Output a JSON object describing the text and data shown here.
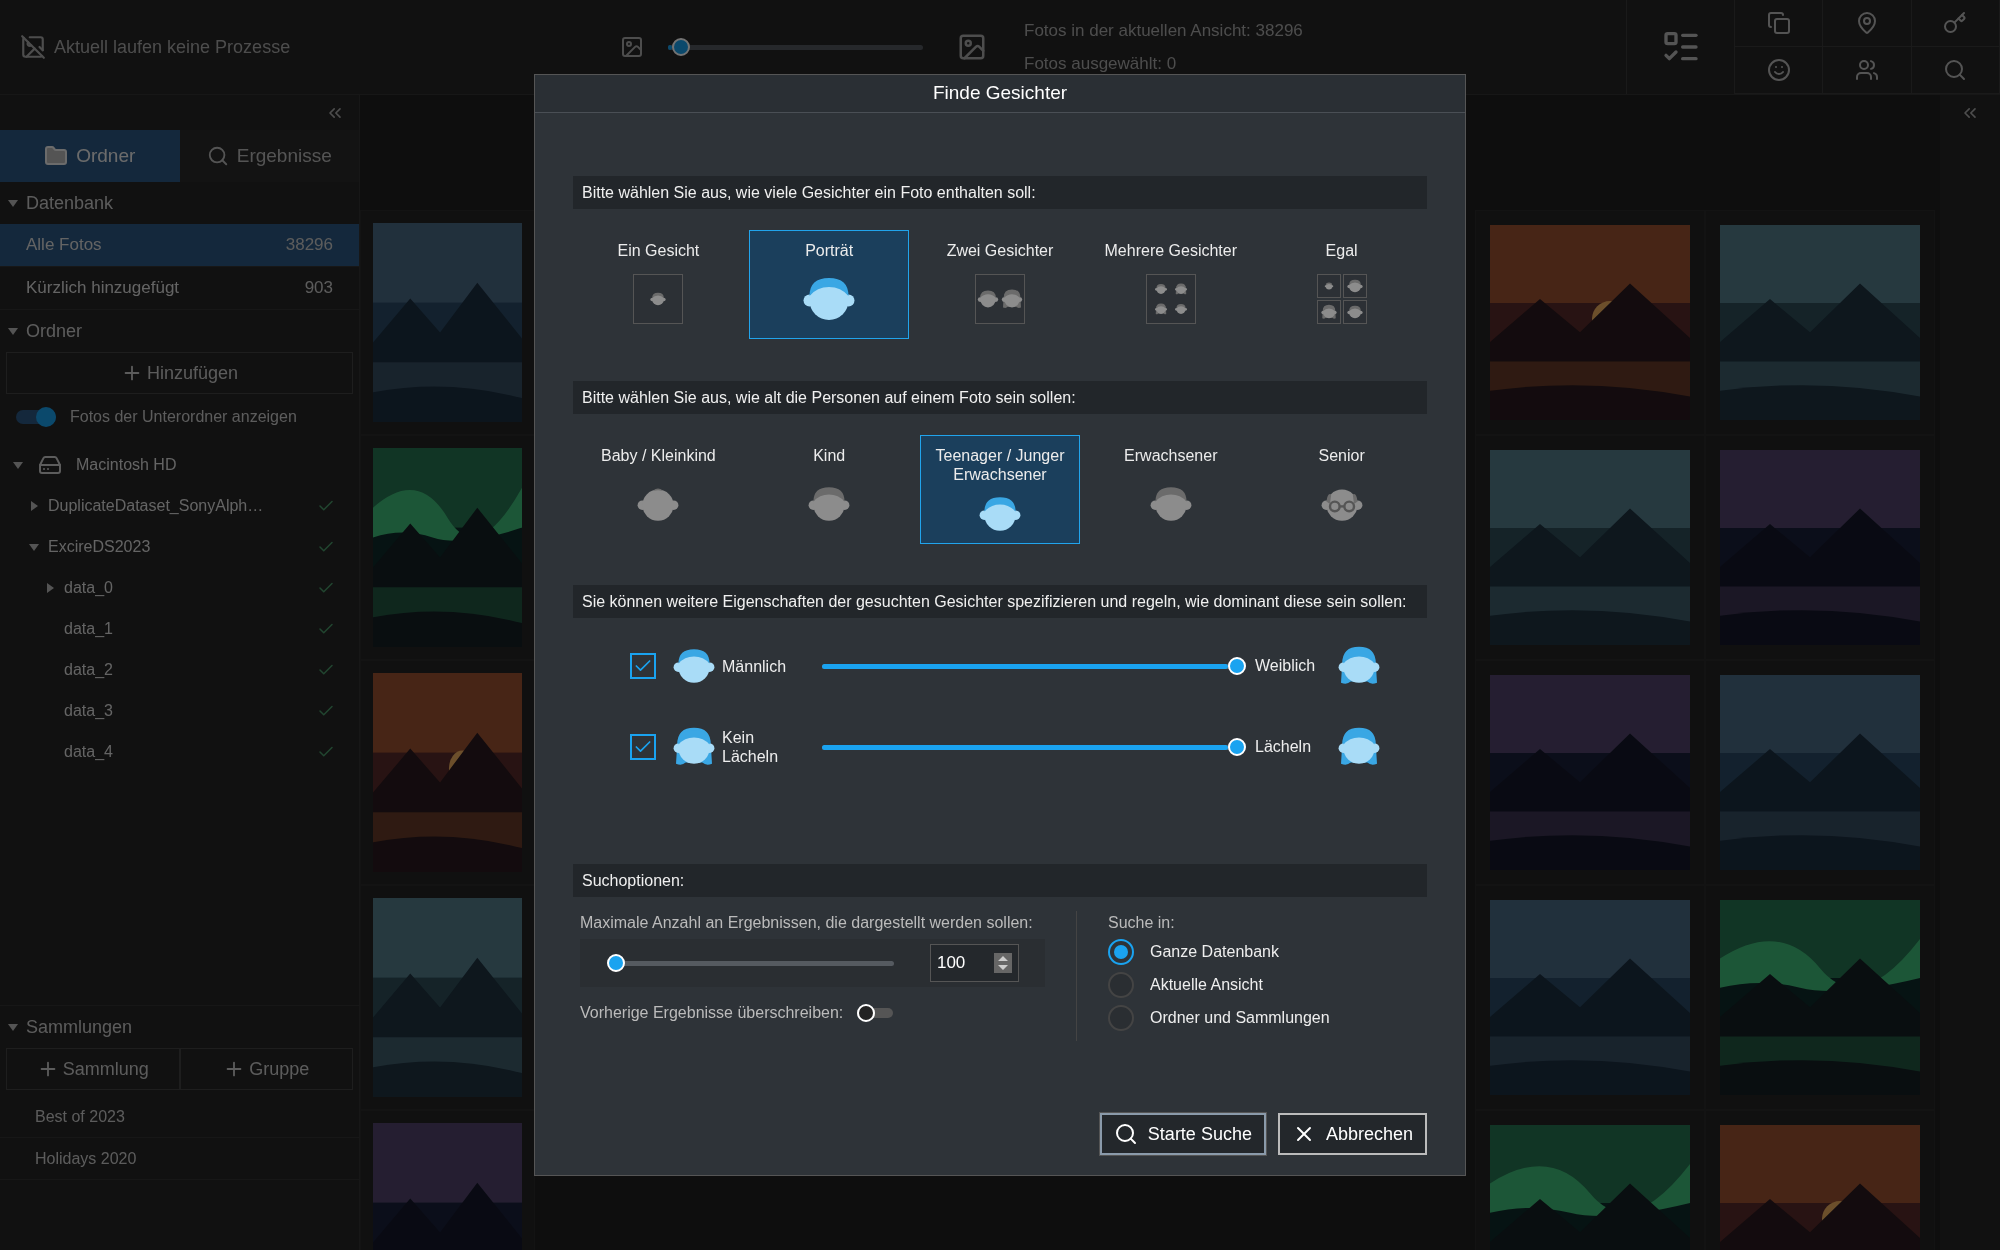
{
  "status": {
    "text": "Aktuell laufen keine Prozesse"
  },
  "thumbnail_size": {
    "level": 0.05
  },
  "stats": [
    "Fotos in der aktuellen Ansicht: 38296",
    "Fotos ausgewählt: 0"
  ],
  "sidebar": {
    "tabs": [
      {
        "label": "Ordner",
        "selected": true
      },
      {
        "label": "Ergebnisse",
        "selected": false
      }
    ],
    "database": {
      "title": "Datenbank",
      "expanded": true,
      "items": [
        {
          "label": "Alle Fotos",
          "count": "38296",
          "selected": true
        },
        {
          "label": "Kürzlich hinzugefügt",
          "count": "903",
          "selected": false
        }
      ]
    },
    "folders": {
      "title": "Ordner",
      "expanded": true,
      "add_button": "Hinzufügen",
      "subfolder_toggle": {
        "label": "Fotos der Unterordner anzeigen",
        "on": true
      },
      "tree": [
        {
          "label": "Macintosh HD",
          "expanded": true,
          "children": [
            {
              "label": "DuplicateDataset_SonyAlph…",
              "expanded": false,
              "checked": true
            },
            {
              "label": "ExcireDS2023",
              "expanded": true,
              "checked": true,
              "children": [
                {
                  "label": "data_0",
                  "expanded": false,
                  "checked": true
                },
                {
                  "label": "data_1",
                  "checked": true
                },
                {
                  "label": "data_2",
                  "checked": true
                },
                {
                  "label": "data_3",
                  "checked": true
                },
                {
                  "label": "data_4",
                  "checked": true
                }
              ]
            }
          ]
        }
      ]
    },
    "collections": {
      "title": "Sammlungen",
      "expanded": true,
      "buttons": [
        "Sammlung",
        "Gruppe"
      ],
      "items": [
        "Best of 2023",
        "Holidays 2020"
      ]
    }
  },
  "dialog": {
    "title": "Finde Gesichter",
    "face_count": {
      "prompt": "Bitte wählen Sie aus, wie viele Gesichter ein Foto enthalten soll:",
      "options": [
        {
          "label": "Ein Gesicht",
          "kind": "one",
          "selected": false
        },
        {
          "label": "Porträt",
          "kind": "portrait",
          "selected": true
        },
        {
          "label": "Zwei Gesichter",
          "kind": "two",
          "selected": false
        },
        {
          "label": "Mehrere Gesichter",
          "kind": "many",
          "selected": false
        },
        {
          "label": "Egal",
          "kind": "any",
          "selected": false
        }
      ]
    },
    "age": {
      "prompt": "Bitte wählen Sie aus, wie alt die Personen auf einem Foto sein sollen:",
      "options": [
        {
          "label": "Baby / Kleinkind",
          "kind": "baby",
          "selected": false
        },
        {
          "label": "Kind",
          "kind": "child",
          "selected": false
        },
        {
          "label": "Teenager / Junger Erwachsener",
          "kind": "teen",
          "selected": true
        },
        {
          "label": "Erwachsener",
          "kind": "adult",
          "selected": false
        },
        {
          "label": "Senior",
          "kind": "senior",
          "selected": false
        }
      ]
    },
    "traits": {
      "prompt": "Sie können weitere Eigenschaften der gesuchten Gesichter spezifizieren und regeln, wie dominant diese sein sollen:",
      "rows": [
        {
          "checked": true,
          "left": {
            "label": "Männlich",
            "kind": "male"
          },
          "right": {
            "label": "Weiblich",
            "kind": "female"
          },
          "level": 1
        },
        {
          "checked": true,
          "left": {
            "label": "Kein Lächeln",
            "kind": "female"
          },
          "right": {
            "label": "Lächeln",
            "kind": "female"
          },
          "level": 1
        }
      ]
    },
    "search_options": {
      "title": "Suchoptionen:",
      "max_results": {
        "label": "Maximale Anzahl an Ergebnissen, die dargestellt werden sollen:",
        "level": 0,
        "value": "100"
      },
      "overwrite": {
        "label": "Vorherige Ergebnisse überschreiben:",
        "on": false
      },
      "scope": {
        "label": "Suche in:",
        "options": [
          {
            "label": "Ganze Datenbank",
            "selected": true
          },
          {
            "label": "Aktuelle Ansicht",
            "selected": false
          },
          {
            "label": "Ordner und Sammlungen",
            "selected": false
          }
        ]
      }
    },
    "buttons": [
      {
        "label": "Starte Suche",
        "kind": "search",
        "focused": true
      },
      {
        "label": "Abbrechen",
        "kind": "cancel",
        "focused": false
      }
    ]
  }
}
